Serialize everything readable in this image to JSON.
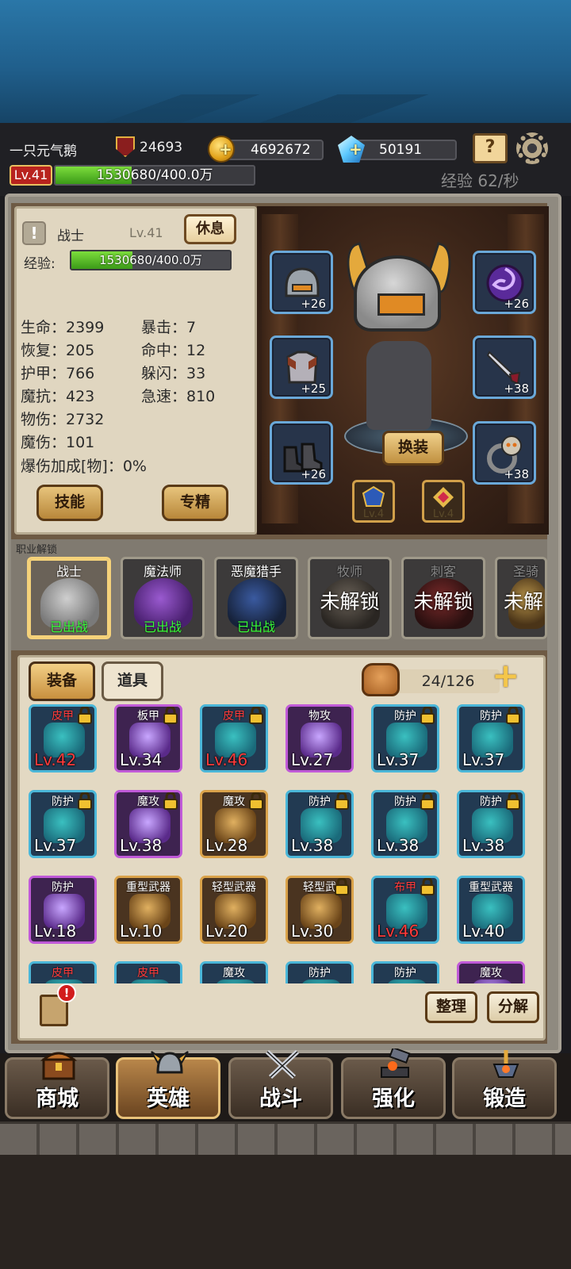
{
  "header": {
    "player_name": "一只元气鹅",
    "power": "24693",
    "gold": "4692672",
    "gems": "50191",
    "level": "Lv.41",
    "xp_text": "1530680/400.0万",
    "xp_fraction": 0.383,
    "xp_rate": "经验 62/秒",
    "icons": [
      "power-shield-icon",
      "gold-coin-icon",
      "diamond-icon",
      "guide-book-icon",
      "settings-gear-icon"
    ]
  },
  "hero": {
    "class_name": "战士",
    "level": "Lv.41",
    "rest_label": "休息",
    "exp_label": "经验:",
    "exp_text": "1530680/400.0万",
    "exp_fraction": 0.383,
    "stats_left": [
      "生命：2399",
      "恢复：205",
      "护甲：766",
      "魔抗：423",
      "物伤：2732",
      "魔伤：101",
      "爆伤加成[物]：0%"
    ],
    "stats_right": [
      "暴击：7",
      "命中：12",
      "躲闪：33",
      "急速：810"
    ],
    "skill_label": "技能",
    "mastery_label": "专精",
    "equip_label": "换装",
    "equipment": [
      {
        "name": "helmet",
        "plus": "+26"
      },
      {
        "name": "armor",
        "plus": "+25"
      },
      {
        "name": "boots",
        "plus": "+26"
      },
      {
        "name": "orb",
        "plus": "+26"
      },
      {
        "name": "weapon",
        "plus": "+38"
      },
      {
        "name": "ring",
        "plus": "+38"
      }
    ],
    "badges": [
      "Lv.4",
      "Lv.4"
    ]
  },
  "classes": {
    "title": "职业解锁",
    "items": [
      {
        "name": "战士",
        "status": "已出战",
        "locked": false
      },
      {
        "name": "魔法师",
        "status": "已出战",
        "locked": false
      },
      {
        "name": "恶魔猎手",
        "status": "已出战",
        "locked": false
      },
      {
        "name": "牧师",
        "status": "未解锁",
        "locked": true
      },
      {
        "name": "刺客",
        "status": "未解锁",
        "locked": true
      },
      {
        "name": "圣骑",
        "status": "未解",
        "locked": true
      }
    ]
  },
  "inventory": {
    "tab_equipment": "装备",
    "tab_items": "道具",
    "capacity": "24/126",
    "sort_label": "整理",
    "decompose_label": "分解",
    "alert": "!",
    "items": [
      {
        "type": "皮甲",
        "lv": "Lv.42",
        "red": true,
        "tone": "blue",
        "lock": true
      },
      {
        "type": "板甲",
        "lv": "Lv.34",
        "red": false,
        "tone": "purple",
        "lock": true
      },
      {
        "type": "皮甲",
        "lv": "Lv.46",
        "red": true,
        "tone": "blue",
        "lock": true
      },
      {
        "type": "物攻",
        "lv": "Lv.27",
        "red": false,
        "tone": "purple",
        "lock": false
      },
      {
        "type": "防护",
        "lv": "Lv.37",
        "red": false,
        "tone": "blue",
        "lock": true
      },
      {
        "type": "防护",
        "lv": "Lv.37",
        "red": false,
        "tone": "blue",
        "lock": true
      },
      {
        "type": "防护",
        "lv": "Lv.37",
        "red": false,
        "tone": "blue",
        "lock": true
      },
      {
        "type": "魔攻",
        "lv": "Lv.38",
        "red": false,
        "tone": "purple",
        "lock": true
      },
      {
        "type": "魔攻",
        "lv": "Lv.28",
        "red": false,
        "tone": "gold",
        "lock": true
      },
      {
        "type": "防护",
        "lv": "Lv.38",
        "red": false,
        "tone": "blue",
        "lock": true
      },
      {
        "type": "防护",
        "lv": "Lv.38",
        "red": false,
        "tone": "blue",
        "lock": true
      },
      {
        "type": "防护",
        "lv": "Lv.38",
        "red": false,
        "tone": "blue",
        "lock": true
      },
      {
        "type": "防护",
        "lv": "Lv.18",
        "red": false,
        "tone": "purple",
        "lock": false
      },
      {
        "type": "重型武器",
        "lv": "Lv.10",
        "red": false,
        "tone": "gold",
        "lock": false
      },
      {
        "type": "轻型武器",
        "lv": "Lv.20",
        "red": false,
        "tone": "gold",
        "lock": false
      },
      {
        "type": "轻型武",
        "lv": "Lv.30",
        "red": false,
        "tone": "gold",
        "lock": true
      },
      {
        "type": "布甲",
        "lv": "Lv.46",
        "red": true,
        "tone": "blue",
        "lock": true
      },
      {
        "type": "重型武器",
        "lv": "Lv.40",
        "red": false,
        "tone": "blue",
        "lock": false
      },
      {
        "type": "皮甲",
        "lv": "",
        "red": true,
        "tone": "blue",
        "lock": false
      },
      {
        "type": "皮甲",
        "lv": "",
        "red": true,
        "tone": "blue",
        "lock": false
      },
      {
        "type": "魔攻",
        "lv": "",
        "red": false,
        "tone": "blue",
        "lock": false
      },
      {
        "type": "防护",
        "lv": "",
        "red": false,
        "tone": "blue",
        "lock": false
      },
      {
        "type": "防护",
        "lv": "",
        "red": false,
        "tone": "blue",
        "lock": false
      },
      {
        "type": "魔攻",
        "lv": "",
        "red": false,
        "tone": "purple",
        "lock": false
      }
    ]
  },
  "nav": [
    {
      "label": "商城",
      "icon": "treasure-chest-icon",
      "active": false
    },
    {
      "label": "英雄",
      "icon": "helmet-icon",
      "active": true
    },
    {
      "label": "战斗",
      "icon": "crossed-swords-icon",
      "active": false
    },
    {
      "label": "强化",
      "icon": "hammer-anvil-icon",
      "active": false
    },
    {
      "label": "锻造",
      "icon": "forge-icon",
      "active": false
    }
  ],
  "colors": {
    "accent_gold": "#e8c27a",
    "xp_green": "#5cc22a",
    "rarity_blue": "#4ab6d8",
    "rarity_purple": "#c05ad8",
    "rarity_gold": "#d9a24a",
    "deployed_green": "#39ff39",
    "warning_red": "#ff3b3b"
  }
}
